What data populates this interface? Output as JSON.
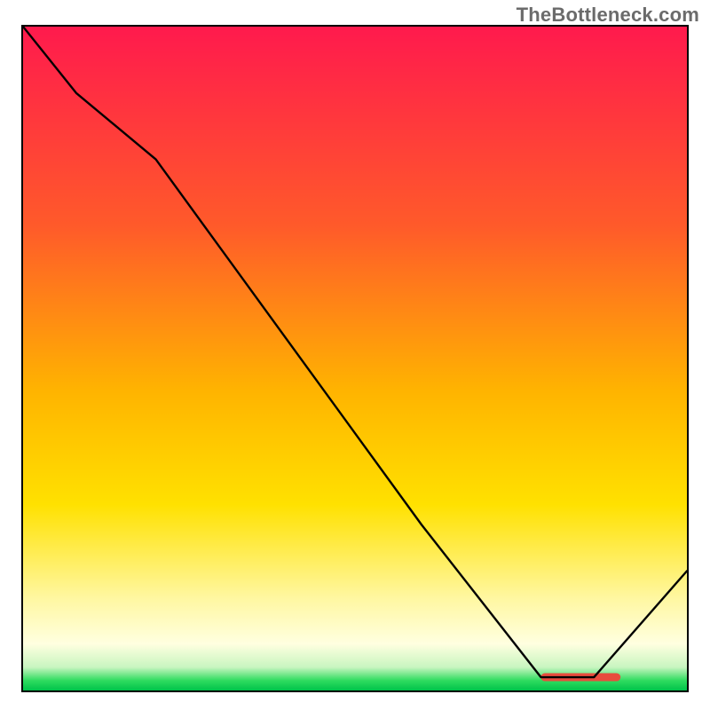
{
  "watermark": "TheBottleneck.com",
  "chart_data": {
    "type": "line",
    "title": "",
    "xlabel": "",
    "ylabel": "",
    "xlim": [
      0,
      100
    ],
    "ylim": [
      0,
      100
    ],
    "curve": {
      "x": [
        0,
        8,
        20,
        60,
        78,
        86,
        100
      ],
      "values": [
        100,
        90,
        80,
        25,
        2,
        2,
        18
      ]
    },
    "background_gradient_stops": [
      {
        "pos": 0.0,
        "color": "#ff1a4d"
      },
      {
        "pos": 0.3,
        "color": "#ff5a2a"
      },
      {
        "pos": 0.55,
        "color": "#ffb400"
      },
      {
        "pos": 0.72,
        "color": "#ffe100"
      },
      {
        "pos": 0.86,
        "color": "#fff7a0"
      },
      {
        "pos": 0.93,
        "color": "#ffffe0"
      },
      {
        "pos": 0.965,
        "color": "#c8f5c0"
      },
      {
        "pos": 0.985,
        "color": "#2fdc5f"
      },
      {
        "pos": 1.0,
        "color": "#00c24a"
      }
    ],
    "optimum_marker": {
      "x_start": 78,
      "x_end": 90,
      "y": 2,
      "label": "",
      "color": "#e84c3d"
    }
  }
}
